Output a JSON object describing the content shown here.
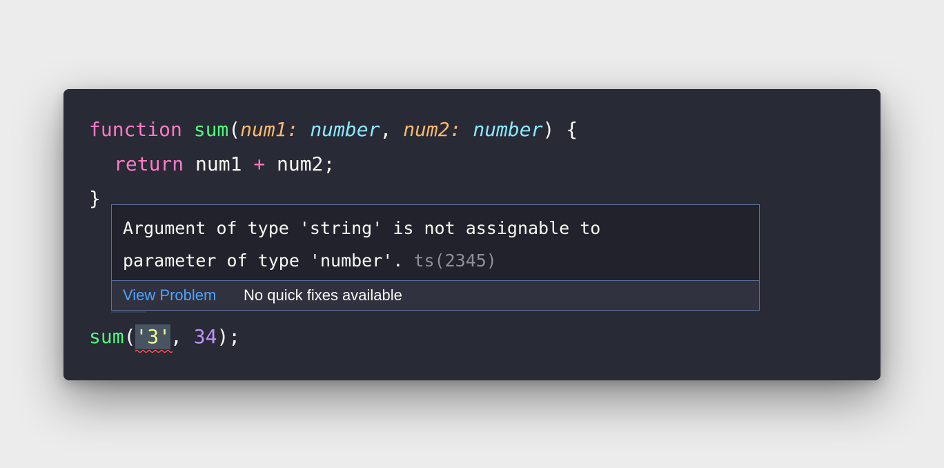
{
  "editor": {
    "line1": {
      "keyword": "function",
      "name": "sum",
      "open": "(",
      "param1": "num1",
      "colon1": ":",
      "type1": "number",
      "comma": ",",
      "param2": "num2",
      "colon2": ":",
      "type2": "number",
      "close": ")",
      "brace": "{"
    },
    "line2": {
      "keyword": "return",
      "left": "num1",
      "operator": "+",
      "right": "num2;"
    },
    "line3": {
      "brace": "}"
    },
    "line4": {
      "name": "sum",
      "open": "(",
      "arg1": "'3'",
      "comma": ",",
      "arg2": "34",
      "close": ");"
    }
  },
  "hover": {
    "message_line1": "Argument of type 'string' is not assignable to",
    "message_line2": "parameter of type 'number'.",
    "error_code": "ts(2345)",
    "view_problem_label": "View Problem",
    "no_fixes_label": "No quick fixes available"
  },
  "colors": {
    "editor_bg": "#282a36",
    "keyword": "#ff79c6",
    "function": "#50fa7b",
    "parameter": "#ffb86c",
    "type": "#8be9fd",
    "number": "#bd93f9",
    "string": "#f1fa8c",
    "link": "#4da3ff",
    "error_squiggle": "#ff5555"
  }
}
